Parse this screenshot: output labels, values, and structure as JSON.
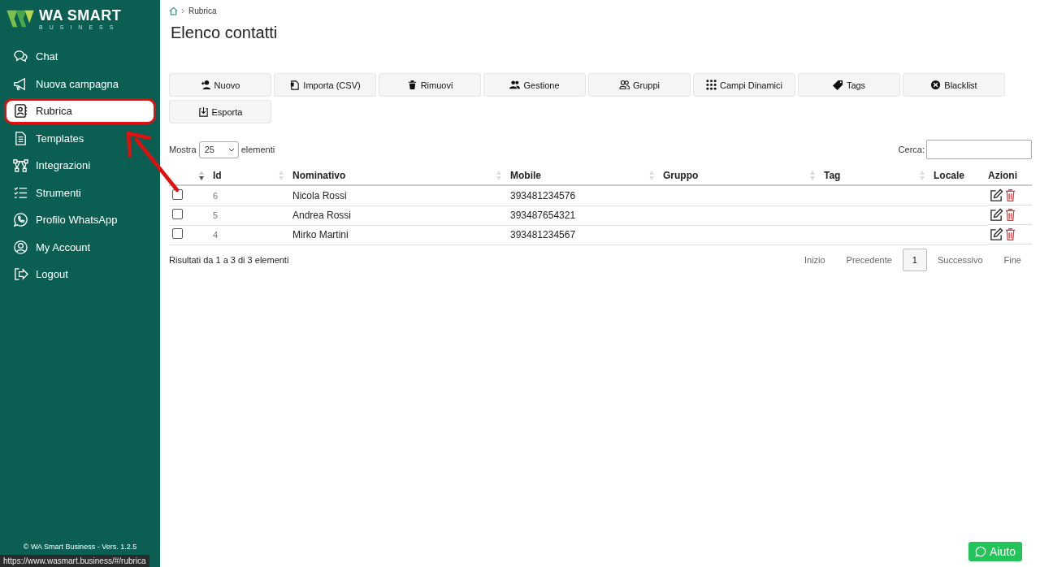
{
  "sidebar": {
    "logo": {
      "title": "WA SMART",
      "subtitle": "BUSINESS"
    },
    "items": [
      {
        "label": "Chat",
        "selected": false
      },
      {
        "label": "Nuova campagna",
        "selected": false
      },
      {
        "label": "Rubrica",
        "selected": true
      },
      {
        "label": "Templates",
        "selected": false
      },
      {
        "label": "Integrazioni",
        "selected": false
      },
      {
        "label": "Strumenti",
        "selected": false
      },
      {
        "label": "Profilo WhatsApp",
        "selected": false
      },
      {
        "label": "My Account",
        "selected": false
      },
      {
        "label": "Logout",
        "selected": false
      }
    ],
    "footer": "© WA Smart Business - Vers. 1.2.5"
  },
  "breadcrumb": [
    "Rubrica"
  ],
  "page_title": "Elenco contatti",
  "toolbar": [
    "Nuovo",
    "Importa (CSV)",
    "Rimuovi",
    "Gestione",
    "Gruppi",
    "Campi Dinamici",
    "Tags",
    "Blacklist",
    "Esporta"
  ],
  "length_control": {
    "before": "Mostra",
    "value": "25",
    "after": "elementi"
  },
  "search": {
    "label": "Cerca:"
  },
  "table": {
    "columns": [
      {
        "label": "Id",
        "sorted": true
      },
      {
        "label": "Nominativo",
        "sorted": false
      },
      {
        "label": "Mobile",
        "sorted": false
      },
      {
        "label": "Gruppo",
        "sorted": false
      },
      {
        "label": "Tag",
        "sorted": false
      },
      {
        "label": "Locale",
        "sorted": false
      },
      {
        "label": "Azioni"
      }
    ],
    "rows": [
      {
        "checked": false,
        "id": "6",
        "name": "Nicola Rossi",
        "mobile": "393481234576"
      },
      {
        "checked": false,
        "id": "5",
        "name": "Andrea Rossi",
        "mobile": "393487654321"
      },
      {
        "checked": false,
        "id": "4",
        "name": "Mirko Martini",
        "mobile": "393481234567"
      }
    ]
  },
  "info": "Risultati da 1 a 3 di 3 elementi",
  "pagination": [
    {
      "label": "Inizio",
      "selected": false
    },
    {
      "label": "Precedente",
      "selected": false
    },
    {
      "label": "1",
      "selected": true
    },
    {
      "label": "Successivo",
      "selected": false
    },
    {
      "label": "Fine",
      "selected": false
    }
  ],
  "help_button": "Aiuto",
  "status_bar": {
    "url": "https://www.wasmart.business/#/rubrica"
  }
}
